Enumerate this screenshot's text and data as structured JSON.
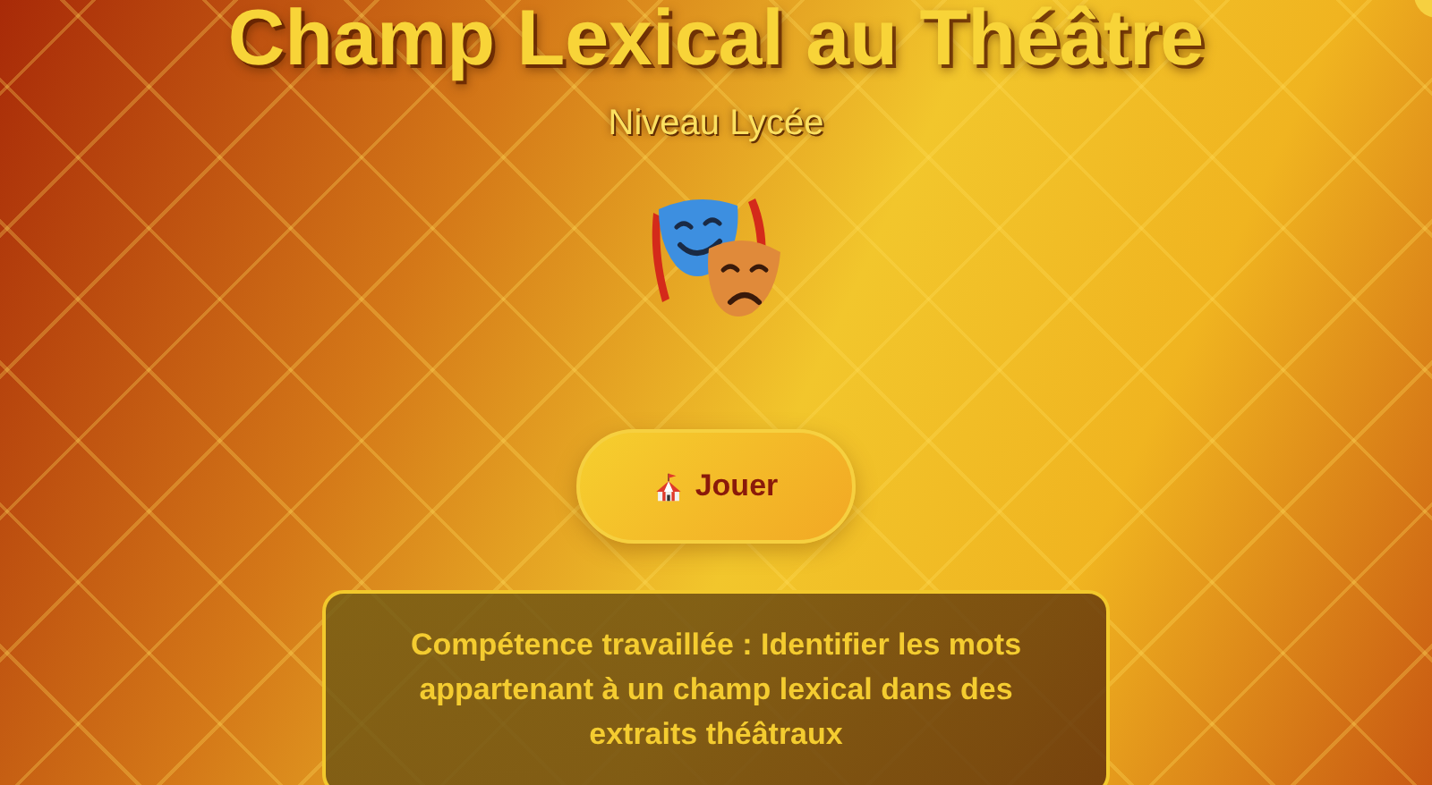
{
  "title": "Champ Lexical au Théâtre",
  "subtitle": "Niveau Lycée",
  "play_button": {
    "label": "Jouer"
  },
  "skill_card": {
    "text": "Compétence travaillée : Identifier les mots appartenant à un champ lexical dans des extraits théâtraux"
  }
}
